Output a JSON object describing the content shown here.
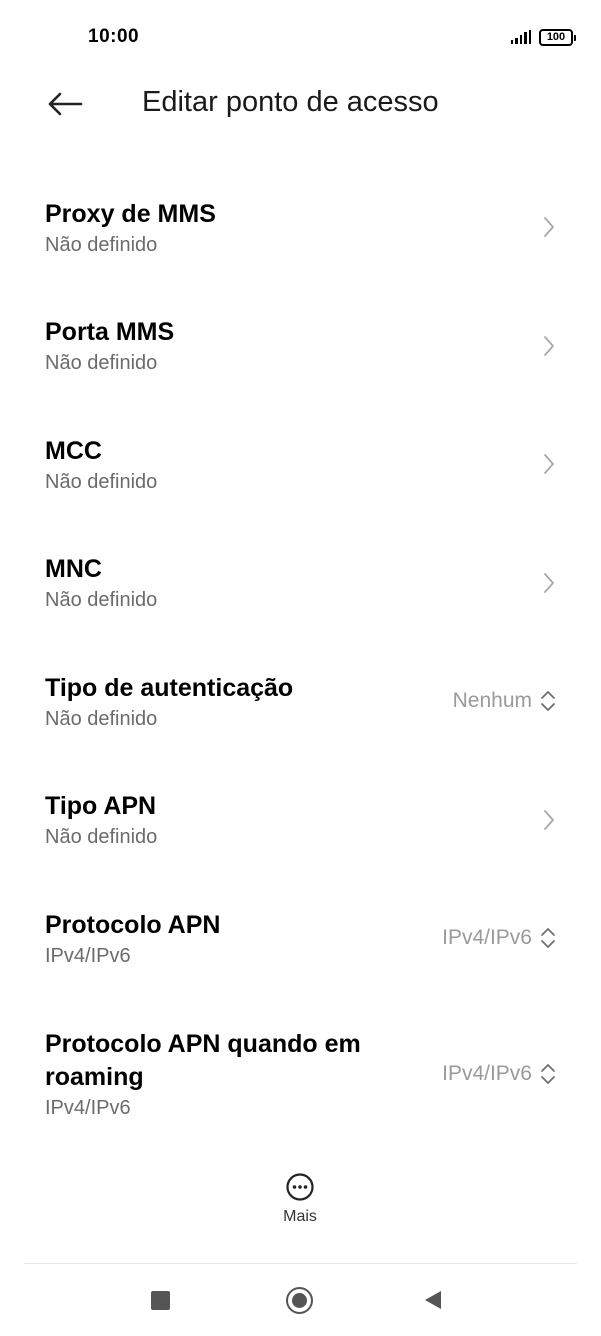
{
  "status_bar": {
    "time": "10:00",
    "battery": "100"
  },
  "header": {
    "title": "Editar ponto de acesso"
  },
  "items": [
    {
      "title": "Proxy de MMS",
      "subtitle": "Não definido",
      "value": "",
      "control": "chevron"
    },
    {
      "title": "Porta MMS",
      "subtitle": "Não definido",
      "value": "",
      "control": "chevron"
    },
    {
      "title": "MCC",
      "subtitle": "Não definido",
      "value": "",
      "control": "chevron"
    },
    {
      "title": "MNC",
      "subtitle": "Não definido",
      "value": "",
      "control": "chevron"
    },
    {
      "title": "Tipo de autenticação",
      "subtitle": "Não definido",
      "value": "Nenhum",
      "control": "dropdown"
    },
    {
      "title": "Tipo APN",
      "subtitle": "Não definido",
      "value": "",
      "control": "chevron"
    },
    {
      "title": "Protocolo APN",
      "subtitle": "IPv4/IPv6",
      "value": "IPv4/IPv6",
      "control": "dropdown"
    },
    {
      "title": "Protocolo APN quando em roaming",
      "subtitle": "IPv4/IPv6",
      "value": "IPv4/IPv6",
      "control": "dropdown"
    }
  ],
  "more": {
    "label": "Mais"
  },
  "colors": {
    "subtitle": "#6b6b6b",
    "value": "#9a9a9a",
    "icon": "#555555"
  }
}
